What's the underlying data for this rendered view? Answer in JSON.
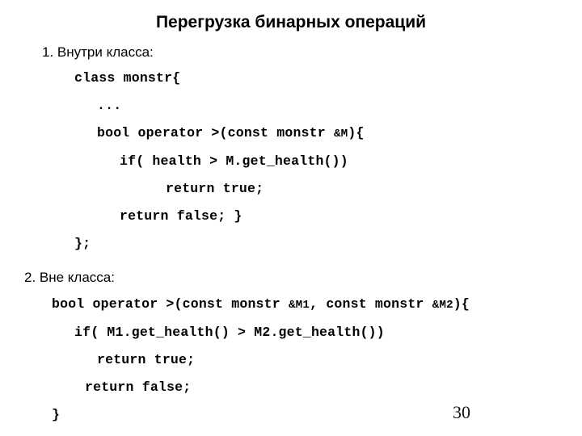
{
  "slide": {
    "title": "Перегрузка бинарных операций",
    "number": "30",
    "sections": [
      {
        "heading": "1. Внутри класса:",
        "code": [
          {
            "indent": 1,
            "text": "class monstr{"
          },
          {
            "indent": 2,
            "text": "..."
          },
          {
            "indent": 2,
            "pre": "bool operator >(const monstr ",
            "ref": "&M",
            "post": "){"
          },
          {
            "indent": 3,
            "text": "if( health > M.get_health())"
          },
          {
            "indent": 5,
            "text": "return true;"
          },
          {
            "indent": 3,
            "text": "return false; }"
          },
          {
            "indent": 1,
            "text": "};"
          }
        ]
      },
      {
        "heading": "2. Вне класса:",
        "code": [
          {
            "indent": 0,
            "pre": "bool operator >(const monstr ",
            "ref": "&M1",
            "mid": ", const monstr ",
            "ref2": "&M2",
            "post": "){"
          },
          {
            "indent": 1,
            "text": "if( M1.get_health() > M2.get_health())"
          },
          {
            "indent": 2,
            "text": "return true;"
          },
          {
            "indent": 1,
            "text": "return false;"
          },
          {
            "indent": 0,
            "text": "}"
          }
        ]
      }
    ]
  }
}
